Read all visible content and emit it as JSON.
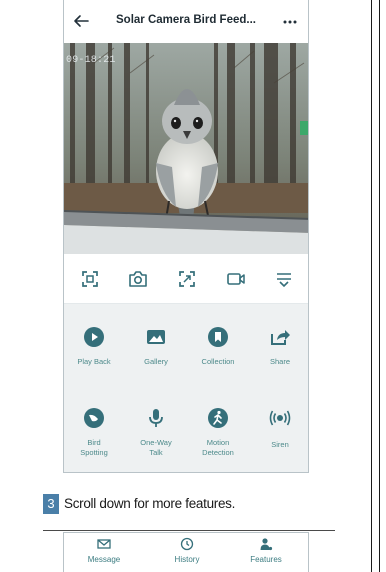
{
  "header": {
    "title": "Solar Camera Bird Feed...",
    "back_icon": "back-arrow-icon",
    "more_icon": "more-dots-icon"
  },
  "video": {
    "timestamp": "09-18:21"
  },
  "controls": [
    {
      "icon": "fullscreen-icon"
    },
    {
      "icon": "snapshot-camera-icon"
    },
    {
      "icon": "zoom-expand-icon"
    },
    {
      "icon": "record-video-icon"
    },
    {
      "icon": "menu-icon"
    }
  ],
  "features": [
    {
      "label": "Play Back",
      "icon": "play-icon"
    },
    {
      "label": "Gallery",
      "icon": "gallery-icon"
    },
    {
      "label": "Collection",
      "icon": "collection-icon"
    },
    {
      "label": "Share",
      "icon": "share-icon"
    },
    {
      "label": "Bird\nSpotting",
      "icon": "bird-spotting-icon"
    },
    {
      "label": "One-Way\nTalk",
      "icon": "microphone-icon"
    },
    {
      "label": "Motion\nDetection",
      "icon": "motion-icon"
    },
    {
      "label": "Siren",
      "icon": "siren-icon"
    }
  ],
  "instruction": {
    "step": "3",
    "text": "Scroll down for more features."
  },
  "tabbar": [
    {
      "label": "Message",
      "icon": "message-icon"
    },
    {
      "label": "History",
      "icon": "history-clock-icon"
    },
    {
      "label": "Features",
      "icon": "features-person-icon"
    }
  ],
  "colors": {
    "accent": "#356f7a",
    "label": "#4d8a8b",
    "panel": "#eef1f2",
    "step_badge": "#4a7fa8"
  }
}
